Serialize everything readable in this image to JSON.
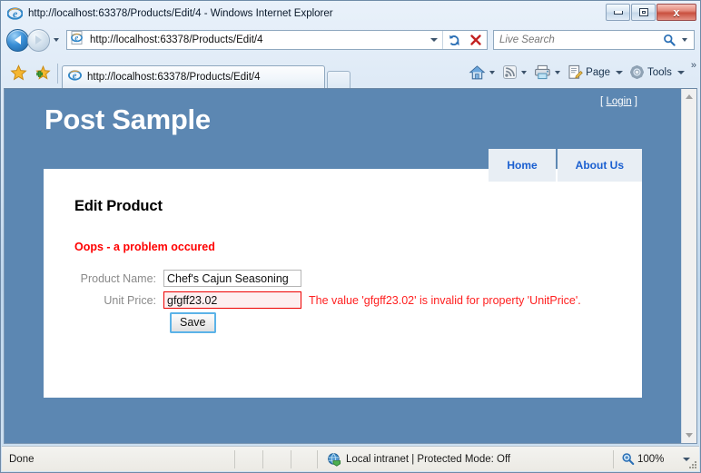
{
  "browser": {
    "title_bar": {
      "text": "http://localhost:63378/Products/Edit/4 - Windows Internet Explorer",
      "app_icon": "ie-logo-icon",
      "minimize_label": "",
      "maximize_label": "",
      "close_label": "x"
    },
    "address_bar": {
      "url": "http://localhost:63378/Products/Edit/4",
      "favicon": "ie-page-icon",
      "back_icon": "back-arrow-icon",
      "forward_icon": "forward-arrow-icon",
      "history_dropdown_icon": "chevron-down-icon",
      "url_dropdown_icon": "chevron-down-icon",
      "refresh_icon": "refresh-icon",
      "stop_icon": "stop-x-icon"
    },
    "search": {
      "placeholder": "Live Search",
      "value": "",
      "search_icon": "magnifier-icon",
      "dropdown_icon": "chevron-down-icon"
    },
    "favorites": {
      "favorites_center_icon": "star-icon",
      "add_to_favorites_icon": "star-plus-icon"
    },
    "tabs": [
      {
        "label": "http://localhost:63378/Products/Edit/4",
        "favicon": "ie-page-icon",
        "active": true
      }
    ],
    "new_tab_icon": "new-tab-icon",
    "command_bar": {
      "home_icon": "home-icon",
      "home_dropdown_icon": "chevron-down-icon",
      "feeds_icon": "rss-feed-icon",
      "feeds_dropdown_icon": "chevron-down-icon",
      "print_icon": "printer-icon",
      "print_dropdown_icon": "chevron-down-icon",
      "page_icon": "page-icon",
      "page_label": "Page",
      "page_dropdown_icon": "chevron-down-icon",
      "tools_icon": "gear-icon",
      "tools_label": "Tools",
      "tools_dropdown_icon": "chevron-down-icon",
      "overflow_label": "»"
    },
    "status_bar": {
      "status_text": "Done",
      "zone_icon": "globe-shield-icon",
      "zone_text": "Local intranet | Protected Mode: Off",
      "zoom_icon": "zoom-magnifier-icon",
      "zoom_level": "100%",
      "zoom_dropdown_icon": "chevron-down-icon"
    },
    "scrollbar": {
      "up_arrow_icon": "scroll-up-icon",
      "down_arrow_icon": "scroll-down-icon"
    }
  },
  "page": {
    "site_title": "Post Sample",
    "login": {
      "prefix": "[",
      "link_label": "Login",
      "suffix": "]"
    },
    "nav": [
      {
        "label": "Home"
      },
      {
        "label": "About Us"
      }
    ],
    "heading": "Edit Product",
    "error_summary": "Oops - a problem occured",
    "form": {
      "fields": [
        {
          "label": "Product Name:",
          "value": "Chef's Cajun Seasoning",
          "has_error": false,
          "error": ""
        },
        {
          "label": "Unit Price:",
          "value": "gfgff23.02",
          "has_error": true,
          "error": "The value 'gfgff23.02' is invalid for property 'UnitPrice'."
        }
      ],
      "submit_label": "Save"
    }
  },
  "colors": {
    "page_background": "#5c87b2",
    "card_background": "#ffffff",
    "nav_tab_background": "#e8eef4",
    "nav_link": "#1a5fd0",
    "error_red": "#ff0000",
    "field_error_border": "#ee0000",
    "field_error_fill": "#fdeff0",
    "label_gray": "#8a8a8a",
    "title_white": "#ffffff"
  }
}
